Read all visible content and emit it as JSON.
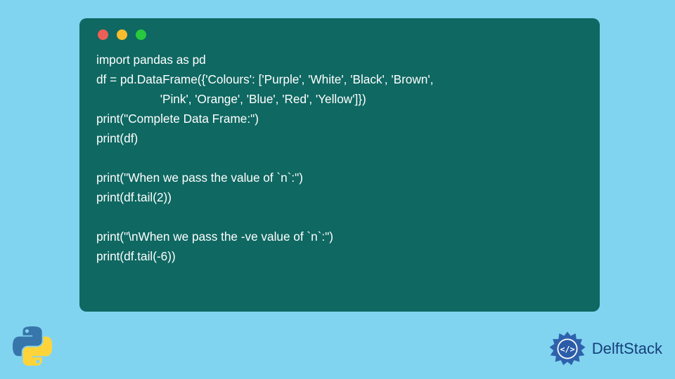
{
  "code": {
    "line1": "import pandas as pd",
    "line2": "df = pd.DataFrame({'Colours': ['Purple', 'White', 'Black', 'Brown',",
    "line3": "                   'Pink', 'Orange', 'Blue', 'Red', 'Yellow']})",
    "line4": "print(\"Complete Data Frame:\")",
    "line5": "print(df)",
    "line6": "",
    "line7": "print(\"When we pass the value of `n`:\")",
    "line8": "print(df.tail(2))",
    "line9": "",
    "line10": "print(\"\\nWhen we pass the -ve value of `n`:\")",
    "line11": "print(df.tail(-6))"
  },
  "branding": {
    "delft_label": "DelftStack"
  },
  "icons": {
    "python": "python-icon",
    "delft_badge": "gear-code-icon"
  },
  "colors": {
    "background": "#81d4f0",
    "window": "#0f6862",
    "code_text": "#ffffff",
    "python_blue": "#3776ab",
    "python_yellow": "#ffd43b",
    "delft_blue": "#2a5ca8"
  }
}
